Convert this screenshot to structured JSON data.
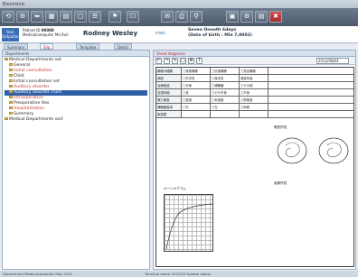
{
  "window": {
    "title": "Electronic"
  },
  "toolbar": {
    "buttons": [
      "⟲",
      "⚙",
      "⬅",
      "▦",
      "▤",
      "▢",
      "☰",
      "⚑",
      "☐",
      "✉",
      "⎙",
      "⚲",
      "▣",
      "⚙",
      "▤",
      "✖"
    ]
  },
  "patient": {
    "badge_line1": "Ikea",
    "badge_line2": "Outpatient",
    "id_label": "Patient ID",
    "id_value": "00000",
    "kana": "Medicalcomputer Ma Ruh",
    "name": "Rodney Wesley",
    "class": "man",
    "info_line1": "Seven Oneoth 6days",
    "info_line2": "(Date of birth : Mie 7,0002)"
  },
  "tabs": [
    "Summary",
    "Slip",
    "Template",
    "Detail"
  ],
  "left_panel": {
    "header": "Departments",
    "tree": [
      {
        "label": "Medical Departments set",
        "style": "normal",
        "indent": 0
      },
      {
        "label": "General",
        "style": "normal",
        "indent": 1
      },
      {
        "label": "Initial consultation",
        "style": "red",
        "indent": 1
      },
      {
        "label": "Child",
        "style": "normal",
        "indent": 1
      },
      {
        "label": "Initial consultation set",
        "style": "normal",
        "indent": 1
      },
      {
        "label": "Auditory disorder",
        "style": "red",
        "indent": 1
      },
      {
        "label": "Auditory disorder chart",
        "style": "selected",
        "indent": 1
      },
      {
        "label": "Intraoperative",
        "style": "red",
        "indent": 1
      },
      {
        "label": "Preoperative Hos",
        "style": "normal",
        "indent": 1
      },
      {
        "label": "Hospitalization",
        "style": "red",
        "indent": 1
      },
      {
        "label": "Summary",
        "style": "normal",
        "indent": 1
      },
      {
        "label": "Medical Departments sort",
        "style": "normal",
        "indent": 0
      }
    ]
  },
  "right_panel": {
    "header": "Sheet diagnosis",
    "date": "2012/08/01",
    "tools": [
      "↶",
      "↷",
      "✎",
      "▢",
      "⚙",
      "T"
    ]
  },
  "form": {
    "rows": [
      [
        "難聴の種類",
        "□感音難聴",
        "□伝音難聴",
        "□混合難聴"
      ],
      [
        "病因",
        "□先天性",
        "□後天性",
        "発症年齢"
      ],
      [
        "治療経過",
        "□手術",
        "□補聴器",
        "□その他"
      ],
      [
        "言語評価",
        "□良",
        "□やや不良",
        "□不良"
      ],
      [
        "聴力検査",
        "□実施",
        "□未実施",
        "□再検査"
      ],
      [
        "補聴器装用",
        "□右",
        "□左",
        "□両側"
      ],
      [
        "家族歴",
        "",
        "",
        ""
      ]
    ],
    "right_label_a": "聴覚所見",
    "right_label_b": "画像所見",
    "chart_label": "オージオグラム"
  },
  "statusbar": {
    "left": "Department  Medicalcomputer  May  2010",
    "right": "Terminal name    2012/05  System status"
  }
}
